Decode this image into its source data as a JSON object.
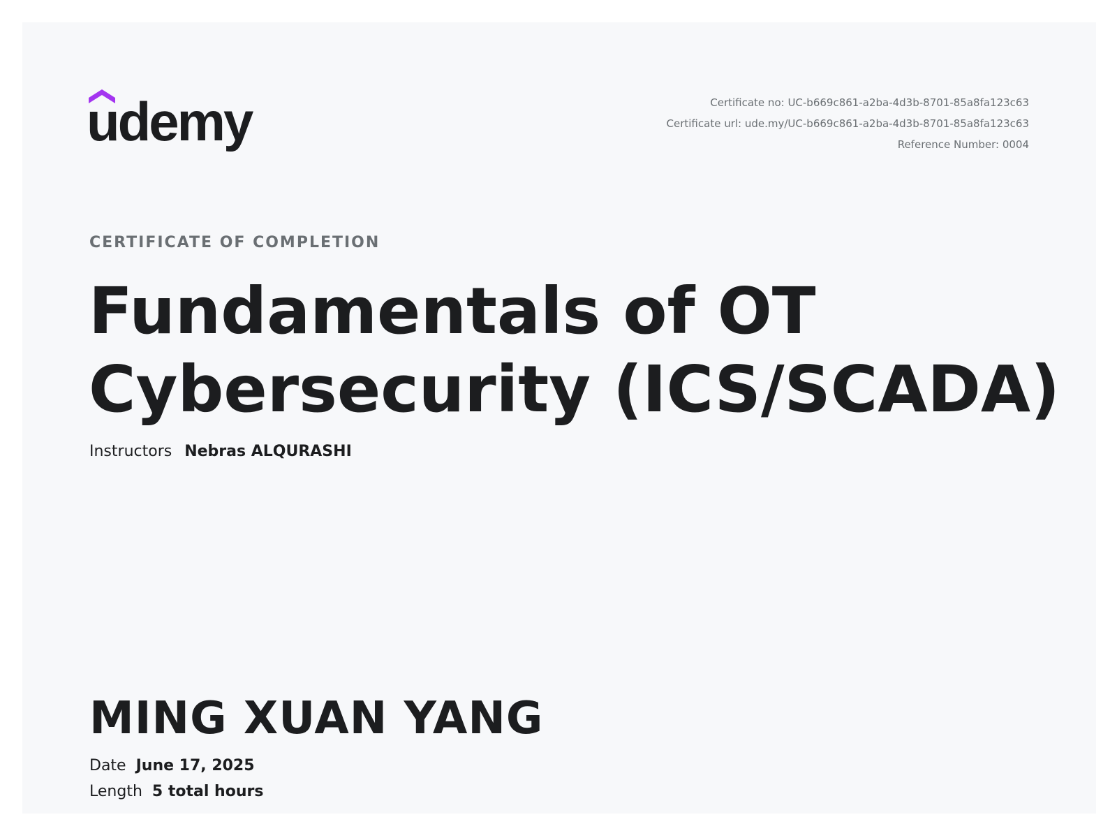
{
  "brand": {
    "name": "udemy",
    "accent_color": "#a435f0",
    "logo_icon": "udemy-logo"
  },
  "meta": {
    "certificate_no": "Certificate no: UC-b669c861-a2ba-4d3b-8701-85a8fa123c63",
    "certificate_url": "Certificate url: ude.my/UC-b669c861-a2ba-4d3b-8701-85a8fa123c63",
    "reference_number": "Reference Number: 0004"
  },
  "certificate": {
    "kicker": "CERTIFICATE OF COMPLETION",
    "course_title_line1": "Fundamentals of OT",
    "course_title_line2": "Cybersecurity (ICS/SCADA)",
    "instructors_label": "Instructors",
    "instructors_value": "Nebras ALQURASHI",
    "recipient": "MING XUAN YANG",
    "date_label": "Date",
    "date_value": "June 17, 2025",
    "length_label": "Length",
    "length_value": "5 total hours"
  },
  "colors": {
    "text_primary": "#1c1d1f",
    "text_secondary": "#6a6f73",
    "background": "#f7f8fa"
  }
}
